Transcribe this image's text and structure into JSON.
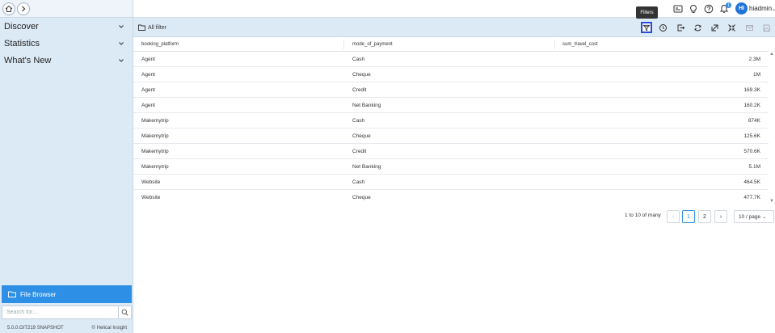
{
  "sidebar": {
    "menu": [
      {
        "label": "Discover"
      },
      {
        "label": "Statistics"
      },
      {
        "label": "What's New"
      }
    ],
    "file_browser_label": "File Browser",
    "search_placeholder": "Search for...",
    "version": "5.0.0.GIT219 SNAPSHOT",
    "brand": "Helical Insight"
  },
  "topbar": {
    "username": "hiadmin",
    "avatar_initials": "HI",
    "notification_count": "1",
    "tooltip": "Filters"
  },
  "filterbar": {
    "label": "All filter"
  },
  "table": {
    "headers": [
      "booking_platform",
      "mode_of_payment",
      "sum_travel_cost"
    ],
    "rows": [
      [
        "Agent",
        "Cash",
        "2.3M"
      ],
      [
        "Agent",
        "Cheque",
        "1M"
      ],
      [
        "Agent",
        "Credit",
        "169.3K"
      ],
      [
        "Agent",
        "Net Banking",
        "160.2K"
      ],
      [
        "Makemytrip",
        "Cash",
        "874K"
      ],
      [
        "Makemytrip",
        "Cheque",
        "125.6K"
      ],
      [
        "Makemytrip",
        "Credit",
        "570.6K"
      ],
      [
        "Makemytrip",
        "Net Banking",
        "5.1M"
      ],
      [
        "Website",
        "Cash",
        "464.5K"
      ],
      [
        "Website",
        "Cheque",
        "477.7K"
      ]
    ]
  },
  "pagination": {
    "info": "1 to 10 of many",
    "pages": [
      "1",
      "2"
    ],
    "current": "1",
    "page_size": "10 / page"
  },
  "colors": {
    "accent": "#2d8fe6",
    "sidebar_bg": "#dceaf6",
    "active_outline": "#2a4bd6"
  }
}
